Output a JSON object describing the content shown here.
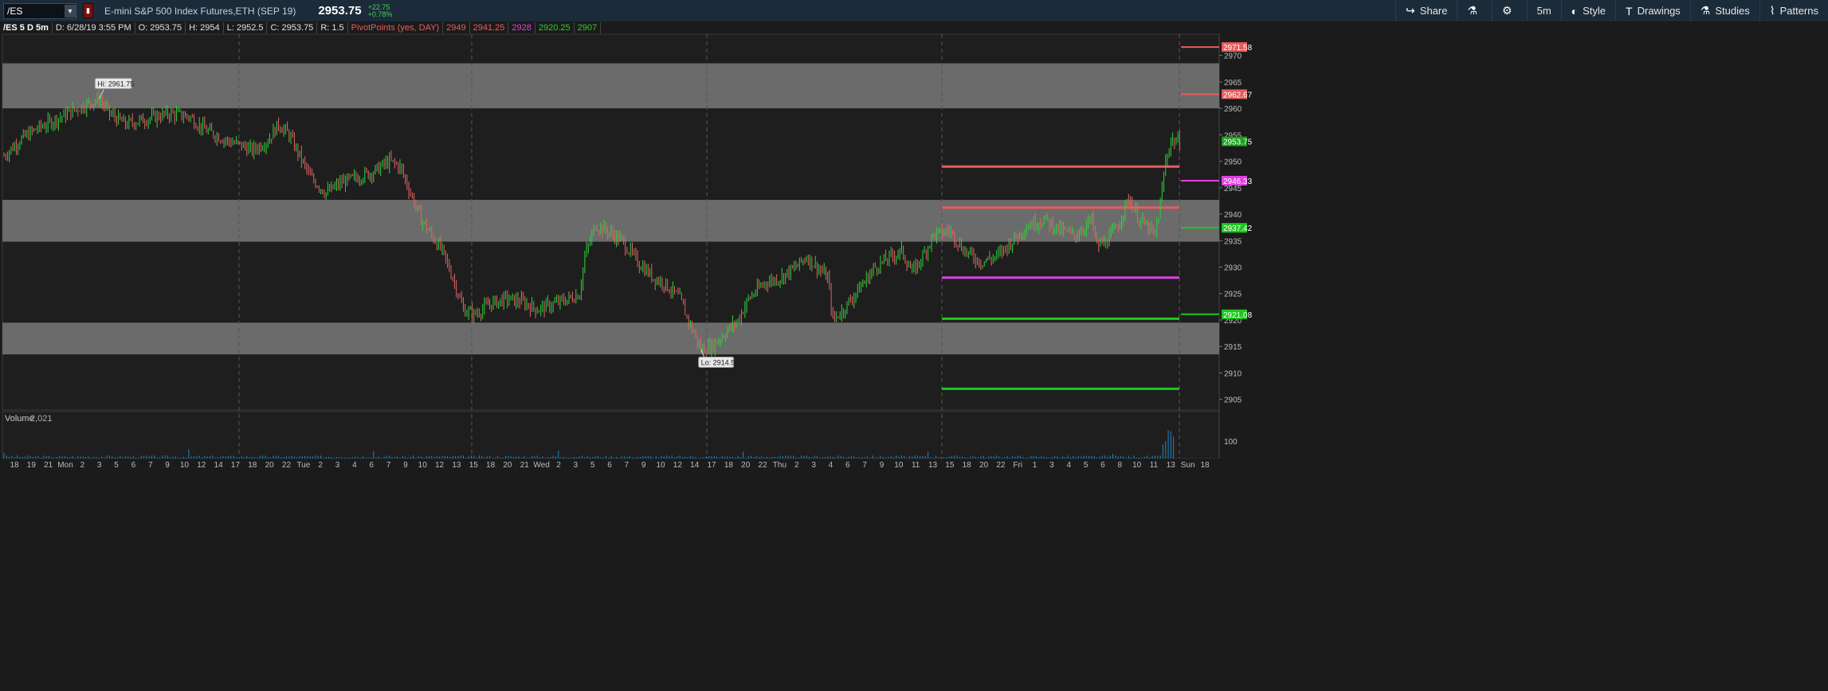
{
  "toolbar": {
    "symbol": "/ES",
    "description": "E-mini S&P 500 Index Futures,ETH (SEP 19)",
    "last_price": "2953.75",
    "change_abs": "+22.75",
    "change_pct": "+0.78%",
    "buttons": [
      {
        "label": "Share",
        "icon": "share-icon"
      },
      {
        "label": "",
        "icon": "flask-icon"
      },
      {
        "label": "",
        "icon": "gear-icon"
      },
      {
        "label": "5m",
        "icon": ""
      },
      {
        "label": "Style",
        "icon": "style-icon"
      },
      {
        "label": "Drawings",
        "icon": "drawings-icon"
      },
      {
        "label": "Studies",
        "icon": "studies-icon"
      },
      {
        "label": "Patterns",
        "icon": "patterns-icon"
      }
    ]
  },
  "info": {
    "title": "/ES 5 D 5m",
    "date": "D: 6/28/19 3:55 PM",
    "open": "O: 2953.75",
    "high": "H: 2954",
    "low": "L: 2952.5",
    "close": "C: 2953.75",
    "range": "R: 1.5",
    "pivot_label": "PivotPoints (yes, DAY)",
    "pivot_values": [
      {
        "text": "2949",
        "color": "#e85c5c"
      },
      {
        "text": "2941.25",
        "color": "#e85c5c"
      },
      {
        "text": "2928",
        "color": "#e040e0"
      },
      {
        "text": "2920.25",
        "color": "#36c636"
      },
      {
        "text": "2907",
        "color": "#36c636"
      }
    ]
  },
  "colors": {
    "up": "#2fd43a",
    "down": "#e06666",
    "r_line": "#e85c5c",
    "pp_line": "#e040e0",
    "s_line": "#1ec81e",
    "zone": "#6b6b6b",
    "volume": "#1e86c8"
  },
  "chart_data": {
    "type": "candlestick",
    "ylim": [
      2903,
      2974
    ],
    "yticks": [
      2905,
      2910,
      2915,
      2920,
      2925,
      2930,
      2935,
      2940,
      2945,
      2950,
      2955,
      2960,
      2965,
      2970
    ],
    "grid": "vertical dashed session separators",
    "gray_zones": [
      [
        2960,
        2968.5
      ],
      [
        2934.8,
        2942.7
      ],
      [
        2913.5,
        2919.5
      ]
    ],
    "pivot_lines": [
      {
        "value": 2949,
        "color": "#e85c5c"
      },
      {
        "value": 2941.25,
        "color": "#e85c5c"
      },
      {
        "value": 2928,
        "color": "#e040e0"
      },
      {
        "value": 2920.25,
        "color": "#1ec81e"
      },
      {
        "value": 2907,
        "color": "#1ec81e"
      }
    ],
    "right_markers": [
      {
        "text": "2971.58",
        "value": 2971.58,
        "color": "#e85c5c"
      },
      {
        "text": "2962.67",
        "value": 2962.67,
        "color": "#e85c5c"
      },
      {
        "text": "2953.75",
        "value": 2953.75,
        "color": "#1ea01e"
      },
      {
        "text": "2946.33",
        "value": 2946.33,
        "color": "#e040e0"
      },
      {
        "text": "2937.42",
        "value": 2937.42,
        "color": "#1ec81e"
      },
      {
        "text": "2921.08",
        "value": 2921.08,
        "color": "#1ec81e"
      }
    ],
    "annotations": [
      {
        "text": "Hi: 2961.75",
        "value": 2961.75
      },
      {
        "text": "Lo: 2914.5",
        "value": 2914.5
      }
    ],
    "price_path": [
      [
        0,
        2951
      ],
      [
        3,
        2954
      ],
      [
        6,
        2956
      ],
      [
        10,
        2958
      ],
      [
        14,
        2960
      ],
      [
        18,
        2961.75
      ],
      [
        20,
        2959
      ],
      [
        23,
        2957
      ],
      [
        27,
        2958
      ],
      [
        31,
        2959
      ],
      [
        35,
        2958.5
      ],
      [
        38,
        2956
      ],
      [
        42,
        2954
      ],
      [
        45,
        2953
      ],
      [
        47,
        2952
      ],
      [
        50,
        2954
      ],
      [
        52,
        2957
      ],
      [
        54,
        2955
      ],
      [
        56,
        2951
      ],
      [
        58,
        2947
      ],
      [
        61,
        2944
      ],
      [
        64,
        2946
      ],
      [
        67,
        2947
      ],
      [
        70,
        2948
      ],
      [
        73,
        2950
      ],
      [
        75,
        2949
      ],
      [
        77,
        2944
      ],
      [
        79,
        2939
      ],
      [
        81,
        2936
      ],
      [
        83,
        2933
      ],
      [
        85,
        2928
      ],
      [
        87,
        2922
      ],
      [
        89,
        2921
      ],
      [
        92,
        2923
      ],
      [
        95,
        2924
      ],
      [
        98,
        2923.5
      ],
      [
        101,
        2922
      ],
      [
        104,
        2923
      ],
      [
        107,
        2924
      ],
      [
        109,
        2925
      ],
      [
        110,
        2932
      ],
      [
        112,
        2938
      ],
      [
        114,
        2937
      ],
      [
        117,
        2935
      ],
      [
        120,
        2931
      ],
      [
        123,
        2928
      ],
      [
        125,
        2927
      ],
      [
        128,
        2924
      ],
      [
        130,
        2919
      ],
      [
        132,
        2914.5
      ],
      [
        134,
        2915
      ],
      [
        136,
        2917
      ],
      [
        139,
        2920
      ],
      [
        141,
        2924
      ],
      [
        144,
        2927
      ],
      [
        147,
        2928
      ],
      [
        150,
        2930
      ],
      [
        152,
        2932
      ],
      [
        154,
        2930
      ],
      [
        156,
        2928
      ],
      [
        157,
        2920
      ],
      [
        159,
        2922
      ],
      [
        162,
        2926
      ],
      [
        165,
        2930
      ],
      [
        168,
        2932
      ],
      [
        170,
        2933
      ],
      [
        172,
        2929
      ],
      [
        174,
        2932
      ],
      [
        176,
        2936
      ],
      [
        179,
        2937
      ],
      [
        182,
        2933
      ],
      [
        185,
        2931
      ],
      [
        188,
        2932
      ],
      [
        191,
        2935
      ],
      [
        194,
        2938
      ],
      [
        197,
        2939
      ],
      [
        200,
        2937
      ],
      [
        203,
        2936
      ],
      [
        206,
        2939
      ],
      [
        207,
        2934
      ],
      [
        209,
        2935
      ],
      [
        211,
        2938
      ],
      [
        213,
        2943
      ],
      [
        215,
        2939
      ],
      [
        217,
        2937
      ],
      [
        218,
        2936
      ],
      [
        219,
        2942
      ],
      [
        220,
        2950
      ],
      [
        221,
        2954
      ],
      [
        222,
        2953.75
      ]
    ],
    "volume": {
      "label": "Volume",
      "value": "2,021",
      "yticks": [
        100
      ]
    },
    "x_tick_labels": [
      "18",
      "19",
      "21",
      "Mon",
      "2",
      "3",
      "5",
      "6",
      "7",
      "9",
      "10",
      "12",
      "14",
      "17",
      "18",
      "20",
      "22",
      "Tue",
      "2",
      "3",
      "4",
      "6",
      "7",
      "9",
      "10",
      "12",
      "13",
      "15",
      "18",
      "20",
      "21",
      "Wed",
      "2",
      "3",
      "5",
      "6",
      "7",
      "9",
      "10",
      "12",
      "14",
      "17",
      "18",
      "20",
      "22",
      "Thu",
      "2",
      "3",
      "4",
      "6",
      "7",
      "9",
      "10",
      "11",
      "13",
      "15",
      "18",
      "20",
      "22",
      "Fri",
      "1",
      "3",
      "4",
      "5",
      "6",
      "8",
      "10",
      "11",
      "13",
      "Sun",
      "18"
    ]
  }
}
